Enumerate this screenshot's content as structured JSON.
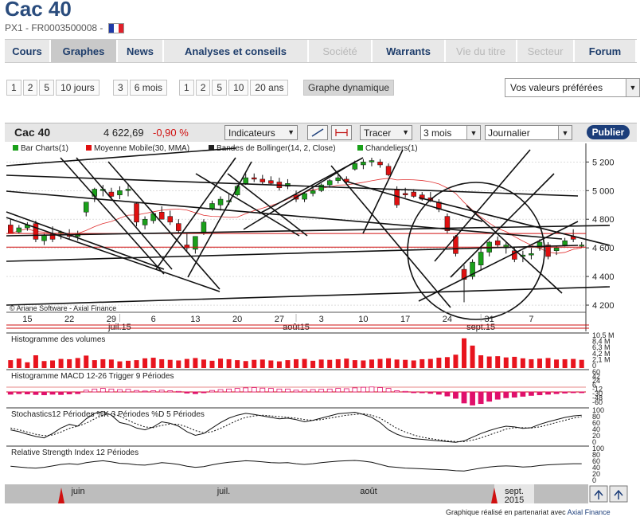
{
  "header": {
    "title": "Cac 40",
    "subtitle": "PX1 - FR0003500008 -",
    "flag_colors": [
      "#1f3aa7",
      "#ffffff",
      "#e0202a"
    ]
  },
  "nav": {
    "tabs": [
      {
        "label": "Cours",
        "state": "normal"
      },
      {
        "label": "Graphes",
        "state": "active"
      },
      {
        "label": "News",
        "state": "normal"
      },
      {
        "label": "Analyses et conseils",
        "state": "normal"
      },
      {
        "label": "Société",
        "state": "disabled"
      },
      {
        "label": "Warrants",
        "state": "normal"
      },
      {
        "label": "Vie du titre",
        "state": "disabled"
      },
      {
        "label": "Secteur",
        "state": "disabled"
      },
      {
        "label": "Forum",
        "state": "normal"
      }
    ]
  },
  "periods": {
    "days": [
      "1",
      "2",
      "5",
      "10 jours"
    ],
    "months": [
      "3",
      "6 mois"
    ],
    "years": [
      "1",
      "2",
      "5",
      "10",
      "20 ans"
    ],
    "dynamic": "Graphe dynamique"
  },
  "favorites": {
    "label": "Vos valeurs préférées"
  },
  "toolbar": {
    "name": "Cac 40",
    "value": "4 622,69",
    "change": "-0,90 %",
    "indicators": "Indicateurs",
    "draw": "Tracer",
    "period": "3 mois",
    "interval": "Journalier",
    "publish": "Publier"
  },
  "credit": {
    "text": "Graphique réalisé en partenariat avec",
    "link": "Axial Finance"
  },
  "colors": {
    "up": "#1aa01a",
    "down": "#e01010",
    "accent": "#1c3e7a",
    "grid": "#c8c8c8"
  },
  "chart_data": {
    "type": "candlestick",
    "legend": [
      "Bar Charts(1)",
      "Moyenne Mobile(30, MMA)",
      "Bandes de Bollinger(14, 2, Close)",
      "Chandeliers(1)"
    ],
    "watermark": "© Ariane Software - Axial Finance",
    "y_ticks": [
      5200,
      5000,
      4800,
      4600,
      4400,
      4200
    ],
    "ylim": [
      4150,
      5330
    ],
    "x_day_labels": [
      "15",
      "22",
      "29",
      "6",
      "13",
      "20",
      "27",
      "3",
      "10",
      "17",
      "24",
      "31",
      "7"
    ],
    "x_month_labels": [
      "juil.15",
      "août15",
      "sept.15"
    ],
    "candles": [
      {
        "o": 4760,
        "h": 4800,
        "l": 4700,
        "c": 4700
      },
      {
        "o": 4710,
        "h": 4760,
        "l": 4700,
        "c": 4740
      },
      {
        "o": 4740,
        "h": 4780,
        "l": 4720,
        "c": 4760
      },
      {
        "o": 4770,
        "h": 4790,
        "l": 4640,
        "c": 4660
      },
      {
        "o": 4650,
        "h": 4700,
        "l": 4620,
        "c": 4690
      },
      {
        "o": 4700,
        "h": 4750,
        "l": 4640,
        "c": 4660
      },
      {
        "o": 4700,
        "h": 4720,
        "l": 4660,
        "c": 4710
      },
      {
        "o": 4690,
        "h": 4730,
        "l": 4660,
        "c": 4680
      },
      {
        "o": 4680,
        "h": 4720,
        "l": 4650,
        "c": 4700
      },
      {
        "o": 4850,
        "h": 4920,
        "l": 4820,
        "c": 4920
      },
      {
        "o": 4960,
        "h": 5020,
        "l": 4920,
        "c": 5010
      },
      {
        "o": 5000,
        "h": 5040,
        "l": 4960,
        "c": 5010
      },
      {
        "o": 4990,
        "h": 5020,
        "l": 4940,
        "c": 4960
      },
      {
        "o": 4970,
        "h": 5030,
        "l": 4940,
        "c": 5000
      },
      {
        "o": 5000,
        "h": 5050,
        "l": 4960,
        "c": 5010
      },
      {
        "o": 4910,
        "h": 4920,
        "l": 4750,
        "c": 4780
      },
      {
        "o": 4760,
        "h": 4820,
        "l": 4730,
        "c": 4800
      },
      {
        "o": 4790,
        "h": 4850,
        "l": 4770,
        "c": 4840
      },
      {
        "o": 4850,
        "h": 4890,
        "l": 4800,
        "c": 4800
      },
      {
        "o": 4820,
        "h": 4860,
        "l": 4760,
        "c": 4780
      },
      {
        "o": 4770,
        "h": 4800,
        "l": 4700,
        "c": 4720
      },
      {
        "o": 4620,
        "h": 4700,
        "l": 4580,
        "c": 4600
      },
      {
        "o": 4590,
        "h": 4680,
        "l": 4560,
        "c": 4680
      },
      {
        "o": 4700,
        "h": 4800,
        "l": 4690,
        "c": 4780
      },
      {
        "o": 4870,
        "h": 4930,
        "l": 4860,
        "c": 4910
      },
      {
        "o": 4900,
        "h": 4960,
        "l": 4860,
        "c": 4940
      },
      {
        "o": 4930,
        "h": 4980,
        "l": 4900,
        "c": 4930
      },
      {
        "o": 4970,
        "h": 5040,
        "l": 4960,
        "c": 5030
      },
      {
        "o": 5050,
        "h": 5120,
        "l": 5040,
        "c": 5090
      },
      {
        "o": 5090,
        "h": 5120,
        "l": 5060,
        "c": 5080
      },
      {
        "o": 5080,
        "h": 5110,
        "l": 5040,
        "c": 5060
      },
      {
        "o": 5070,
        "h": 5100,
        "l": 5040,
        "c": 5050
      },
      {
        "o": 5060,
        "h": 5090,
        "l": 5000,
        "c": 5020
      },
      {
        "o": 5030,
        "h": 5080,
        "l": 5010,
        "c": 5050
      },
      {
        "o": 4970,
        "h": 5000,
        "l": 4920,
        "c": 4940
      },
      {
        "o": 4940,
        "h": 4990,
        "l": 4920,
        "c": 4980
      },
      {
        "o": 4980,
        "h": 5020,
        "l": 4960,
        "c": 5000
      },
      {
        "o": 5000,
        "h": 5050,
        "l": 4990,
        "c": 5040
      },
      {
        "o": 5040,
        "h": 5080,
        "l": 5020,
        "c": 5070
      },
      {
        "o": 5070,
        "h": 5110,
        "l": 5050,
        "c": 5090
      },
      {
        "o": 5080,
        "h": 5100,
        "l": 5040,
        "c": 5060
      },
      {
        "o": 5150,
        "h": 5210,
        "l": 5140,
        "c": 5190
      },
      {
        "o": 5180,
        "h": 5220,
        "l": 5150,
        "c": 5200
      },
      {
        "o": 5200,
        "h": 5230,
        "l": 5170,
        "c": 5210
      },
      {
        "o": 5200,
        "h": 5220,
        "l": 5160,
        "c": 5180
      },
      {
        "o": 5170,
        "h": 5190,
        "l": 5100,
        "c": 5110
      },
      {
        "o": 5010,
        "h": 5030,
        "l": 4880,
        "c": 4900
      },
      {
        "o": 4980,
        "h": 5020,
        "l": 4950,
        "c": 4970
      },
      {
        "o": 4990,
        "h": 5010,
        "l": 4950,
        "c": 4960
      },
      {
        "o": 4970,
        "h": 4990,
        "l": 4930,
        "c": 4940
      },
      {
        "o": 4950,
        "h": 4990,
        "l": 4920,
        "c": 4930
      },
      {
        "o": 4920,
        "h": 4940,
        "l": 4850,
        "c": 4870
      },
      {
        "o": 4820,
        "h": 4840,
        "l": 4700,
        "c": 4720
      },
      {
        "o": 4680,
        "h": 4690,
        "l": 4540,
        "c": 4560
      },
      {
        "o": 4450,
        "h": 4480,
        "l": 4220,
        "c": 4380
      },
      {
        "o": 4400,
        "h": 4520,
        "l": 4380,
        "c": 4500
      },
      {
        "o": 4480,
        "h": 4600,
        "l": 4440,
        "c": 4570
      },
      {
        "o": 4570,
        "h": 4650,
        "l": 4540,
        "c": 4640
      },
      {
        "o": 4650,
        "h": 4680,
        "l": 4600,
        "c": 4620
      },
      {
        "o": 4600,
        "h": 4640,
        "l": 4560,
        "c": 4620
      },
      {
        "o": 4580,
        "h": 4600,
        "l": 4500,
        "c": 4520
      },
      {
        "o": 4540,
        "h": 4580,
        "l": 4500,
        "c": 4550
      },
      {
        "o": 4550,
        "h": 4600,
        "l": 4520,
        "c": 4560
      },
      {
        "o": 4600,
        "h": 4660,
        "l": 4580,
        "c": 4640
      },
      {
        "o": 4620,
        "h": 4640,
        "l": 4520,
        "c": 4540
      },
      {
        "o": 4580,
        "h": 4610,
        "l": 4550,
        "c": 4600
      },
      {
        "o": 4620,
        "h": 4670,
        "l": 4610,
        "c": 4650
      },
      {
        "o": 4680,
        "h": 4730,
        "l": 4640,
        "c": 4660
      },
      {
        "o": 4620,
        "h": 4640,
        "l": 4600,
        "c": 4620
      }
    ],
    "volume_panel": {
      "title": "Histogramme des volumes",
      "y_ticks": [
        "10,5 M",
        "8,4 M",
        "6,3 M",
        "4,2 M",
        "2,1 M",
        "0"
      ],
      "ymax": 10.5,
      "values": [
        2.6,
        3.1,
        1.9,
        4.2,
        2.3,
        2.5,
        3.0,
        2.9,
        3.3,
        4.1,
        2.6,
        2.9,
        2.8,
        2.2,
        2.4,
        2.6,
        3.2,
        3.4,
        2.9,
        2.7,
        2.5,
        3.0,
        3.3,
        2.8,
        2.4,
        3.1,
        2.9,
        2.6,
        2.3,
        2.7,
        2.8,
        2.5,
        2.2,
        2.6,
        2.9,
        3.0,
        2.4,
        2.8,
        2.7,
        2.9,
        3.1,
        2.6,
        2.5,
        2.8,
        3.0,
        3.2,
        2.8,
        2.7,
        2.5,
        2.9,
        3.0,
        3.4,
        3.6,
        4.4,
        9.8,
        7.4,
        4.2,
        3.8,
        3.9,
        3.5,
        3.7,
        3.2,
        2.9,
        3.1,
        3.3,
        2.8,
        2.9,
        3.0,
        2.7
      ]
    },
    "macd_panel": {
      "title": "Histogramme MACD 12-26",
      "trigger": "Trigger 9 Périodes",
      "y_ticks": [
        "60",
        "42",
        "24",
        "6",
        "-12",
        "-30",
        "-48",
        "-60"
      ],
      "ylim": [
        -60,
        60
      ],
      "values": [
        -8,
        -6,
        -7,
        -9,
        -10,
        -8,
        -9,
        -7,
        -6,
        6,
        10,
        12,
        10,
        8,
        9,
        5,
        3,
        4,
        6,
        4,
        2,
        -4,
        -6,
        -3,
        5,
        8,
        10,
        12,
        14,
        15,
        13,
        12,
        10,
        10,
        6,
        7,
        8,
        9,
        10,
        12,
        11,
        14,
        16,
        17,
        15,
        12,
        4,
        2,
        -1,
        -3,
        -5,
        -8,
        -14,
        -22,
        -38,
        -45,
        -40,
        -32,
        -25,
        -20,
        -18,
        -15,
        -12,
        -10,
        -8,
        -6,
        -4,
        -2,
        -1
      ]
    },
    "stoch_panel": {
      "title": "Stochastics12 Périodes",
      "k_label": "%K 3 Périodes",
      "d_label": "%D 5 Périodes",
      "y_ticks": [
        "100",
        "80",
        "60",
        "40",
        "20",
        "0"
      ],
      "k": [
        40,
        35,
        28,
        22,
        18,
        30,
        45,
        55,
        50,
        70,
        85,
        90,
        80,
        60,
        55,
        45,
        40,
        48,
        62,
        58,
        50,
        35,
        25,
        30,
        45,
        60,
        72,
        80,
        85,
        82,
        78,
        74,
        70,
        72,
        68,
        62,
        66,
        72,
        78,
        84,
        86,
        88,
        82,
        74,
        60,
        40,
        28,
        20,
        16,
        14,
        12,
        10,
        8,
        6,
        10,
        20,
        30,
        38,
        45,
        50,
        48,
        44,
        46,
        55,
        62,
        68,
        74,
        78,
        80
      ],
      "d": [
        45,
        40,
        34,
        28,
        24,
        26,
        34,
        44,
        50,
        58,
        70,
        80,
        84,
        78,
        66,
        56,
        48,
        46,
        52,
        56,
        55,
        48,
        38,
        32,
        35,
        44,
        55,
        66,
        74,
        78,
        80,
        78,
        76,
        74,
        72,
        68,
        66,
        68,
        72,
        76,
        80,
        82,
        84,
        80,
        72,
        58,
        44,
        34,
        26,
        20,
        16,
        13,
        10,
        8,
        8,
        12,
        18,
        26,
        34,
        42,
        46,
        46,
        45,
        48,
        54,
        60,
        66,
        72,
        76
      ]
    },
    "rsi_panel": {
      "title": "Relative Strength Index 12 Périodes",
      "y_ticks": [
        "100",
        "80",
        "60",
        "40",
        "20",
        "0"
      ],
      "values": [
        45,
        43,
        41,
        40,
        42,
        46,
        50,
        52,
        50,
        55,
        58,
        60,
        57,
        53,
        52,
        49,
        48,
        51,
        55,
        53,
        50,
        45,
        42,
        44,
        49,
        53,
        56,
        58,
        60,
        59,
        57,
        55,
        54,
        55,
        52,
        50,
        52,
        55,
        57,
        59,
        60,
        61,
        59,
        56,
        50,
        44,
        42,
        40,
        39,
        38,
        37,
        36,
        35,
        33,
        32,
        36,
        40,
        43,
        45,
        46,
        45,
        43,
        44,
        47,
        49,
        50,
        51,
        52,
        52
      ]
    },
    "overview": {
      "month_labels": [
        "juin",
        "juil.",
        "août",
        "sept. 2015"
      ]
    }
  }
}
